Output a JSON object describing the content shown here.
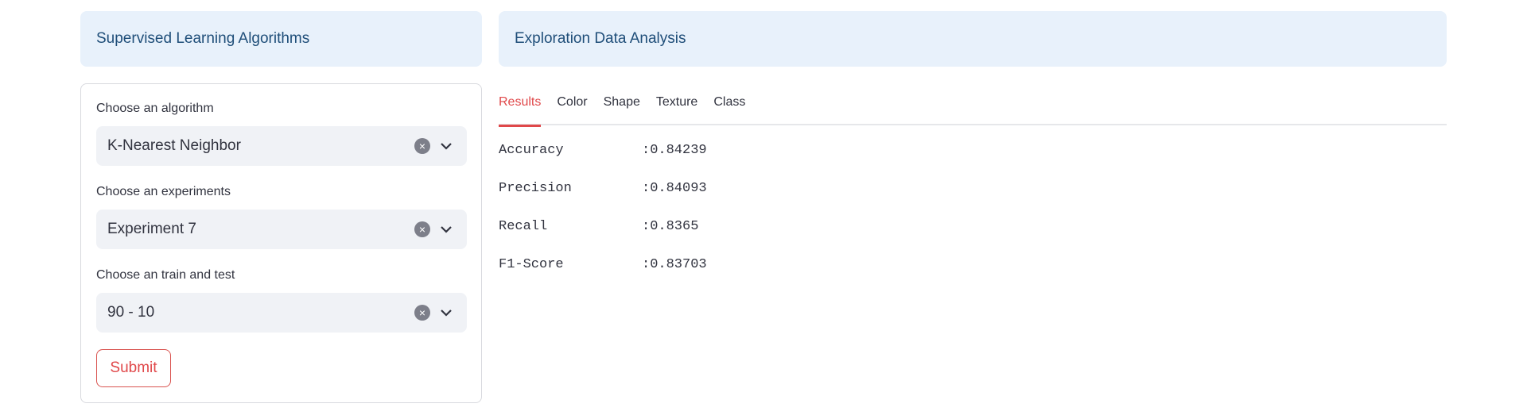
{
  "header": {
    "left_title": "Supervised Learning Algorithms",
    "right_title": "Exploration Data Analysis"
  },
  "form": {
    "algorithm": {
      "label": "Choose an algorithm",
      "value": "K-Nearest Neighbor"
    },
    "experiment": {
      "label": "Choose an experiments",
      "value": "Experiment 7"
    },
    "split": {
      "label": "Choose an train and test",
      "value": "90 - 10"
    },
    "submit_label": "Submit"
  },
  "tabs": [
    {
      "label": "Results",
      "active": true
    },
    {
      "label": "Color",
      "active": false
    },
    {
      "label": "Shape",
      "active": false
    },
    {
      "label": "Texture",
      "active": false
    },
    {
      "label": "Class",
      "active": false
    }
  ],
  "metrics": [
    {
      "name": "Accuracy",
      "value": ":0.84239"
    },
    {
      "name": "Precision",
      "value": ":0.84093"
    },
    {
      "name": "Recall",
      "value": ":0.8365"
    },
    {
      "name": "F1-Score",
      "value": ":0.83703"
    }
  ],
  "colors": {
    "accent": "#e0484a",
    "info_bg": "#e8f1fb",
    "select_bg": "#f0f2f6"
  }
}
